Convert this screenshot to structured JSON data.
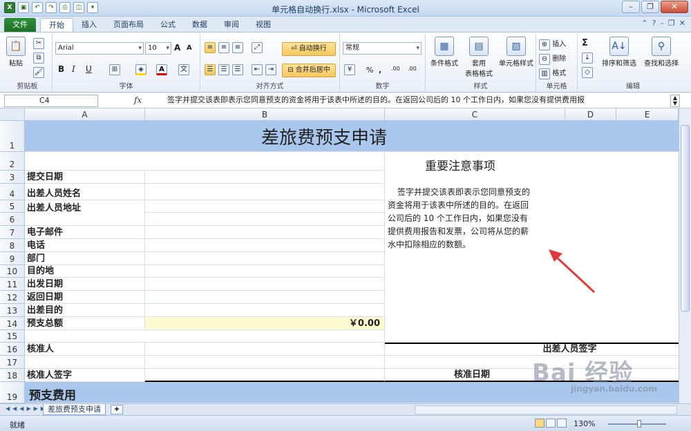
{
  "window": {
    "title": "单元格自动换行.xlsx - Microsoft Excel"
  },
  "ribbon_tabs": [
    "文件",
    "开始",
    "插入",
    "页面布局",
    "公式",
    "数据",
    "审阅",
    "视图"
  ],
  "ribbon": {
    "clipboard": {
      "paste": "粘贴",
      "group": "剪贴板"
    },
    "font": {
      "name": "Arial",
      "size": "10",
      "group": "字体",
      "bold": "B",
      "italic": "I",
      "underline": "U",
      "grow": "A",
      "shrink": "A"
    },
    "alignment": {
      "wrap_text": "自动换行",
      "merge_center": "合并后居中",
      "group": "对齐方式"
    },
    "number": {
      "format": "常规",
      "percent": "%",
      "comma": ",",
      "inc": ".00",
      "dec": ".00",
      "group": "数字"
    },
    "styles": {
      "conditional": "条件格式",
      "table": "套用",
      "table2": "表格格式",
      "cell_style": "单元格样式",
      "group": "样式"
    },
    "cells": {
      "insert": "插入",
      "delete": "删除",
      "format": "格式",
      "group": "单元格"
    },
    "editing": {
      "sort_filter": "排序和筛选",
      "find_select": "查找和选择",
      "group": "编辑",
      "sigma": "Σ"
    }
  },
  "formula_bar": {
    "name_box": "C4",
    "fx": "fx",
    "content": "签字并提交该表即表示您同意预支的资金将用于该表中所述的目的。在返回公司后的 10 个工作日内，如果您没有提供费用报"
  },
  "columns": [
    "A",
    "B",
    "C",
    "D",
    "E"
  ],
  "rows": [
    "1",
    "2",
    "3",
    "4",
    "5",
    "6",
    "7",
    "8",
    "9",
    "10",
    "11",
    "12",
    "13",
    "14",
    "15",
    "16",
    "17",
    "18",
    "19"
  ],
  "sheet": {
    "title": "差旅费预支申请",
    "notice_title": "重要注意事项",
    "notice_text": [
      "签字并提交该表即表示您同意预支的",
      "资金将用于该表中所述的目的。在返回",
      "公司后的 10 个工作日内，如果您没有",
      "提供费用报告和发票，公司将从您的薪",
      "水中扣除相应的数额。"
    ],
    "labels": {
      "r3": "提交日期",
      "r4": "出差人员姓名",
      "r5": "出差人员地址",
      "r7": "电子邮件",
      "r8": "电话",
      "r9": "部门",
      "r10": "目的地",
      "r11": "出发日期",
      "r12": "返回日期",
      "r13": "出差目的",
      "r14": "预支总额",
      "r16": "核准人",
      "r18": "核准人签字",
      "r19": "预支费用"
    },
    "total_value": "￥0.00",
    "traveler_signature": "出差人员签字",
    "approval_date": "核准日期"
  },
  "sheet_tabs": [
    "差旅费预支申请"
  ],
  "status": {
    "ready": "就绪",
    "zoom": "130%"
  },
  "watermark": {
    "logo": "Bai 经验",
    "url": "jingyan.baidu.com"
  },
  "colors": {
    "band": "#a9c7ec",
    "total_fill": "#fffbd0",
    "arrow": "#e03a3a",
    "file_tab": "#2f8f3a"
  }
}
